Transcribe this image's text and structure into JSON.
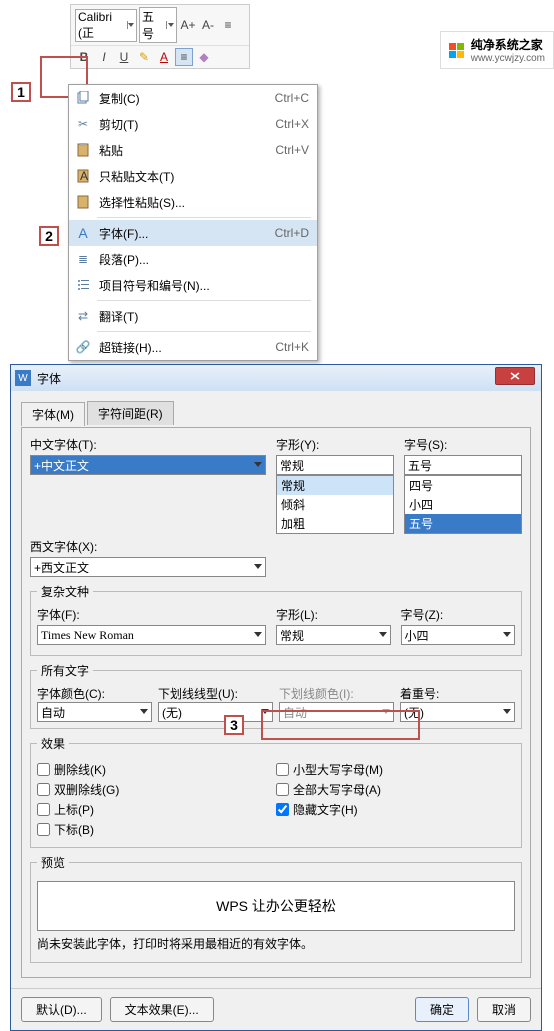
{
  "toolbar": {
    "font": "Calibri (正",
    "size": "五号"
  },
  "menu": {
    "copy": {
      "label": "复制(C)",
      "sc": "Ctrl+C"
    },
    "cut": {
      "label": "剪切(T)",
      "sc": "Ctrl+X"
    },
    "paste": {
      "label": "粘贴",
      "sc": "Ctrl+V"
    },
    "pastetext": {
      "label": "只粘贴文本(T)"
    },
    "pastespecial": {
      "label": "选择性粘贴(S)..."
    },
    "font": {
      "label": "字体(F)...",
      "sc": "Ctrl+D"
    },
    "para": {
      "label": "段落(P)..."
    },
    "bullets": {
      "label": "项目符号和编号(N)..."
    },
    "translate": {
      "label": "翻译(T)"
    },
    "hyperlink": {
      "label": "超链接(H)...",
      "sc": "Ctrl+K"
    }
  },
  "callouts": {
    "c1": "1",
    "c2": "2",
    "c3": "3"
  },
  "dlg": {
    "title": "字体",
    "tabFont": "字体(M)",
    "tabSpacing": "字符间距(R)",
    "cnFontLab": "中文字体(T):",
    "cnFont": "+中文正文",
    "styleLab": "字形(Y):",
    "style": "常规",
    "sizeLab": "字号(S):",
    "size": "五号",
    "styleList": [
      "常规",
      "倾斜",
      "加粗"
    ],
    "sizeList": [
      "四号",
      "小四",
      "五号"
    ],
    "enFontLab": "西文字体(X):",
    "enFont": "+西文正文",
    "complex": "复杂文种",
    "cxFontLab": "字体(F):",
    "cxFont": "Times New Roman",
    "cxStyleLab": "字形(L):",
    "cxStyle": "常规",
    "cxSizeLab": "字号(Z):",
    "cxSize": "小四",
    "allText": "所有文字",
    "colorLab": "字体颜色(C):",
    "color": "自动",
    "ulLab": "下划线线型(U):",
    "ul": "(无)",
    "ulcLab": "下划线颜色(I):",
    "ulc": "自动",
    "emphLab": "着重号:",
    "emph": "(无)",
    "effects": "效果",
    "eStrike": "删除线(K)",
    "eDStrike": "双删除线(G)",
    "eSup": "上标(P)",
    "eSub": "下标(B)",
    "eSmall": "小型大写字母(M)",
    "eAll": "全部大写字母(A)",
    "eHidden": "隐藏文字(H)",
    "preview": "预览",
    "previewText": "WPS 让办公更轻松",
    "note": "尚未安装此字体，打印时将采用最相近的有效字体。",
    "btnDefault": "默认(D)...",
    "btnTextFx": "文本效果(E)...",
    "btnOk": "确定",
    "btnCancel": "取消"
  },
  "watermark": {
    "t1": "纯净系统之家",
    "t2": "www.ycwjzy.com"
  }
}
